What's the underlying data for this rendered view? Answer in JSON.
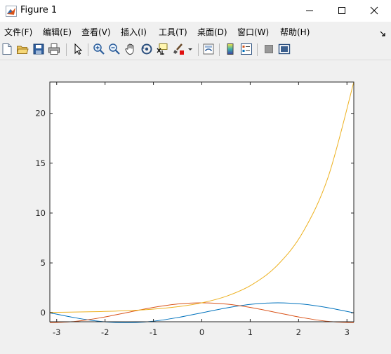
{
  "window": {
    "title": "Figure 1"
  },
  "menu": {
    "items": [
      "文件(F)",
      "编辑(E)",
      "查看(V)",
      "插入(I)",
      "工具(T)",
      "桌面(D)",
      "窗口(W)",
      "帮助(H)"
    ]
  },
  "toolbar": {
    "icons": [
      "new-figure-icon",
      "open-file-icon",
      "save-icon",
      "print-icon",
      "edit-plot-arrow-icon",
      "zoom-in-icon",
      "zoom-out-icon",
      "pan-hand-icon",
      "rotate-3d-icon",
      "data-cursor-icon",
      "brush-icon",
      "brush-dropdown-icon",
      "link-plot-icon",
      "colorbar-icon",
      "legend-icon",
      "hide-plot-tools-icon",
      "show-plot-tools-icon"
    ]
  },
  "colors": {
    "series1": "#0072bd",
    "series2": "#d95319",
    "series3": "#edb120",
    "axes": "#262626",
    "plot_bg": "#ffffff",
    "figure_bg": "#f0f0f0"
  },
  "chart_data": {
    "type": "line",
    "title": "",
    "xlabel": "",
    "ylabel": "",
    "xlim": [
      -3.1416,
      3.1416
    ],
    "ylim": [
      -0.9,
      23.14
    ],
    "xticks": [
      -3,
      -2,
      -1,
      0,
      1,
      2,
      3
    ],
    "yticks": [
      0,
      5,
      10,
      15,
      20
    ],
    "grid": false,
    "legend": "none",
    "x": [
      -3.1416,
      -2.618,
      -2.0944,
      -1.5708,
      -1.0472,
      -0.5236,
      0,
      0.5236,
      1.0472,
      1.5708,
      2.0944,
      2.618,
      3.1416
    ],
    "series": [
      {
        "values": [
          0,
          -0.5,
          -0.866,
          -1,
          -0.866,
          -0.5,
          0,
          0.5,
          0.866,
          1,
          0.866,
          0.5,
          0
        ]
      },
      {
        "values": [
          -1,
          -0.866,
          -0.5,
          0,
          0.5,
          0.866,
          1,
          0.866,
          0.5,
          0,
          -0.5,
          -0.866,
          -1
        ]
      },
      {
        "values": [
          0.0432,
          0.0729,
          0.1231,
          0.2079,
          0.3509,
          0.5924,
          1,
          1.688,
          2.8497,
          4.8105,
          8.1205,
          13.7081,
          23.1407
        ]
      }
    ]
  }
}
